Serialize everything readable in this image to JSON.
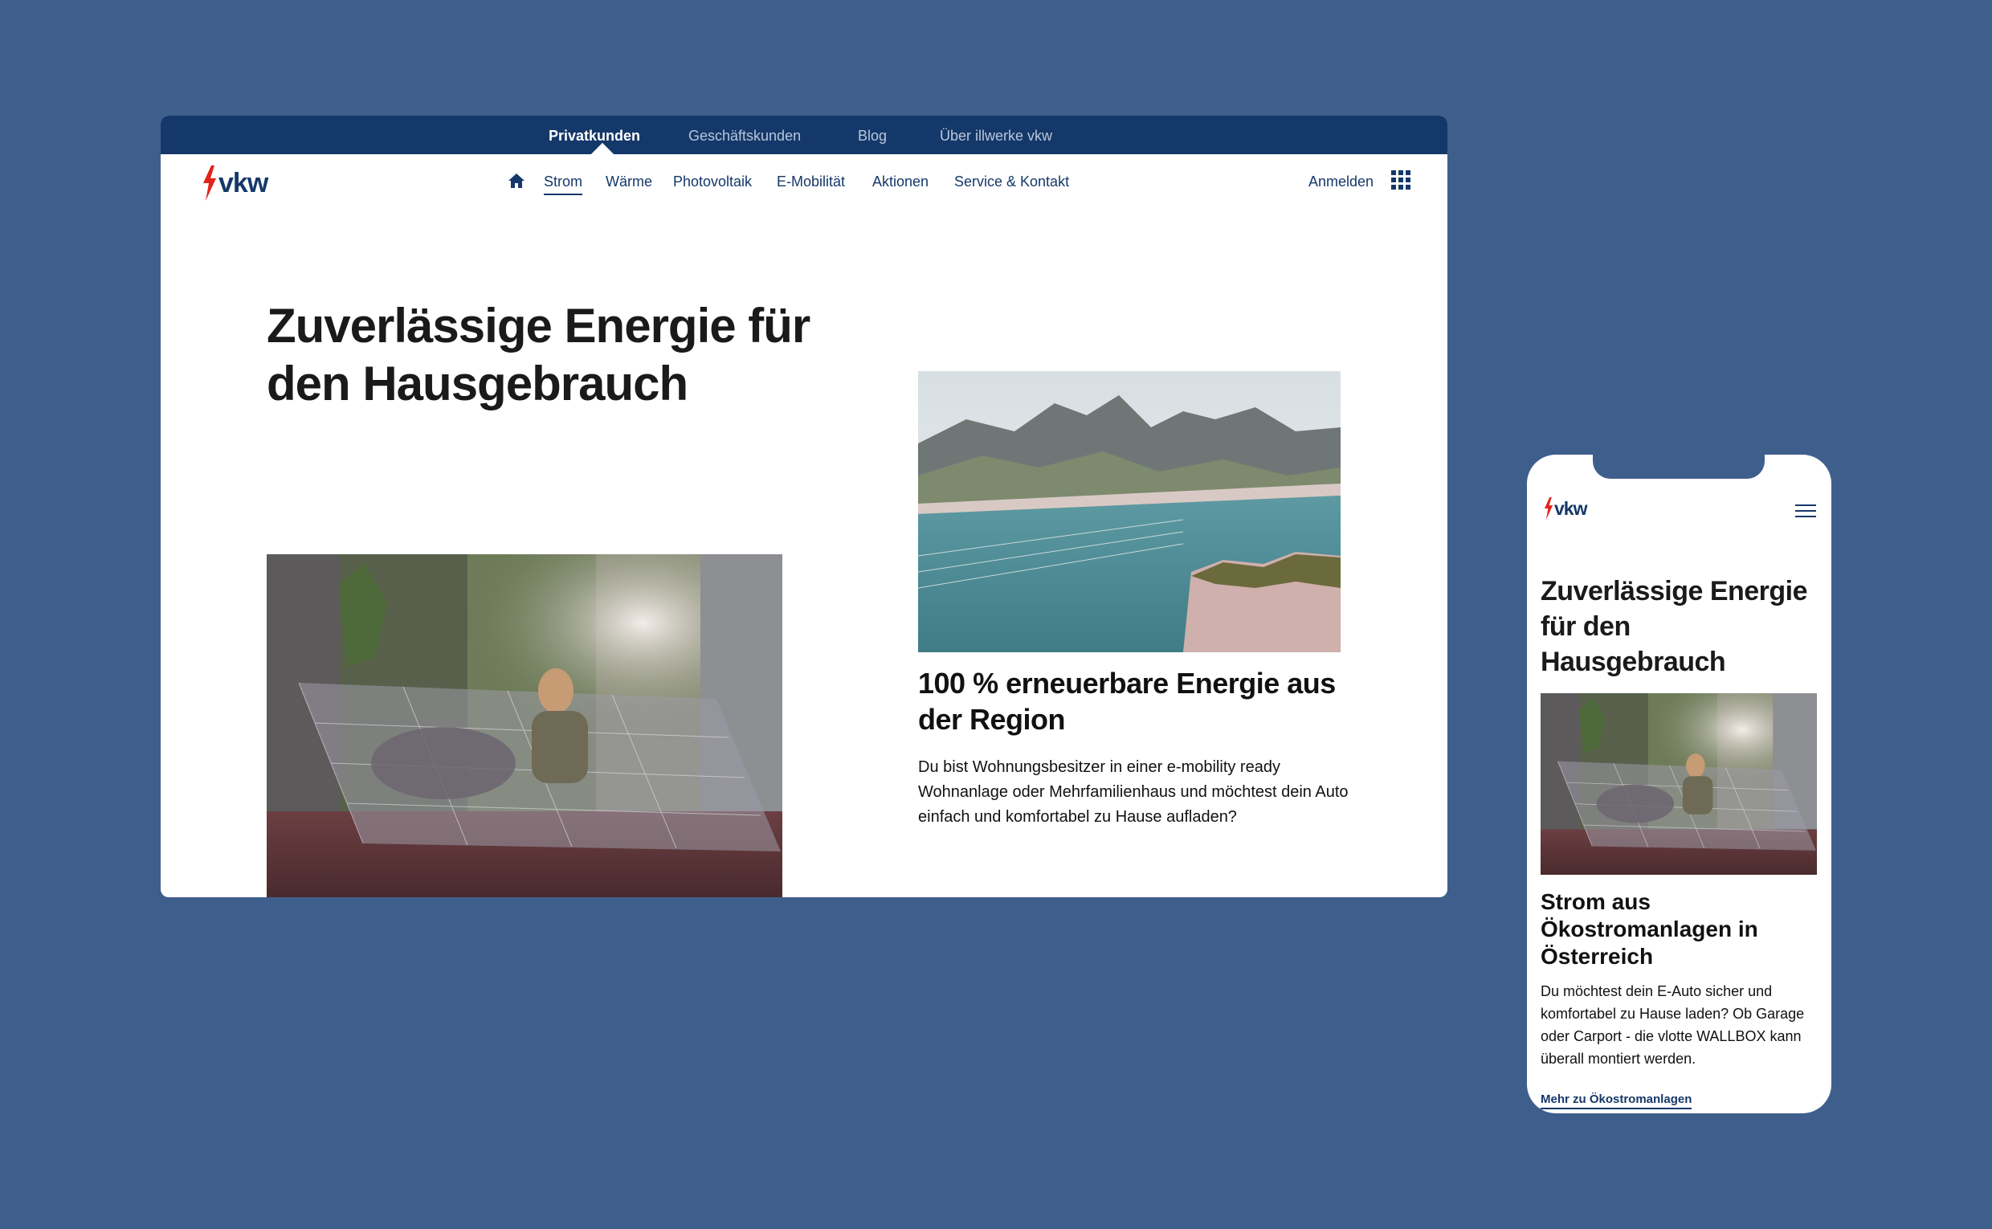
{
  "colors": {
    "background": "#3e5f8c",
    "brand_navy": "#15386a",
    "logo_red": "#e2231a",
    "text_dark": "#1a1a1a"
  },
  "brand": {
    "logo_text": "vkw"
  },
  "desktop": {
    "topbar": {
      "items": [
        {
          "label": "Privatkunden",
          "active": true
        },
        {
          "label": "Geschäftskunden",
          "active": false
        },
        {
          "label": "Blog",
          "active": false
        },
        {
          "label": "Über illwerke vkw",
          "active": false
        }
      ]
    },
    "mainnav": {
      "home_icon": "home-icon",
      "items": [
        {
          "label": "Strom",
          "active": true
        },
        {
          "label": "Wärme",
          "active": false
        },
        {
          "label": "Photovoltaik",
          "active": false
        },
        {
          "label": "E-Mobilität",
          "active": false
        },
        {
          "label": "Aktionen",
          "active": false
        },
        {
          "label": "Service & Kontakt",
          "active": false
        }
      ],
      "login_label": "Anmelden",
      "apps_icon": "grid-icon"
    },
    "hero": {
      "headline": "Zuverlässige Energie für den Hausgebrauch"
    },
    "card": {
      "title": "100 % erneuerbare Energie aus der Region",
      "text": "Du bist Wohnungsbesitzer in einer e-mobility ready Wohnanlage oder Mehrfamilienhaus und möchtest dein Auto einfach und komfortabel zu Hause aufladen?"
    }
  },
  "mobile": {
    "menu_icon": "hamburger-icon",
    "hero": {
      "headline": "Zuverlässige Energie für den Hausgebrauch"
    },
    "card": {
      "title": "Strom aus Ökostromanlagen in Österreich",
      "text": "Du möchtest dein E-Auto sicher und komfortabel zu Hause laden? Ob Garage oder Carport - die vlotte WALLBOX kann überall montiert werden.",
      "link_label": "Mehr zu Ökostromanlagen"
    }
  }
}
